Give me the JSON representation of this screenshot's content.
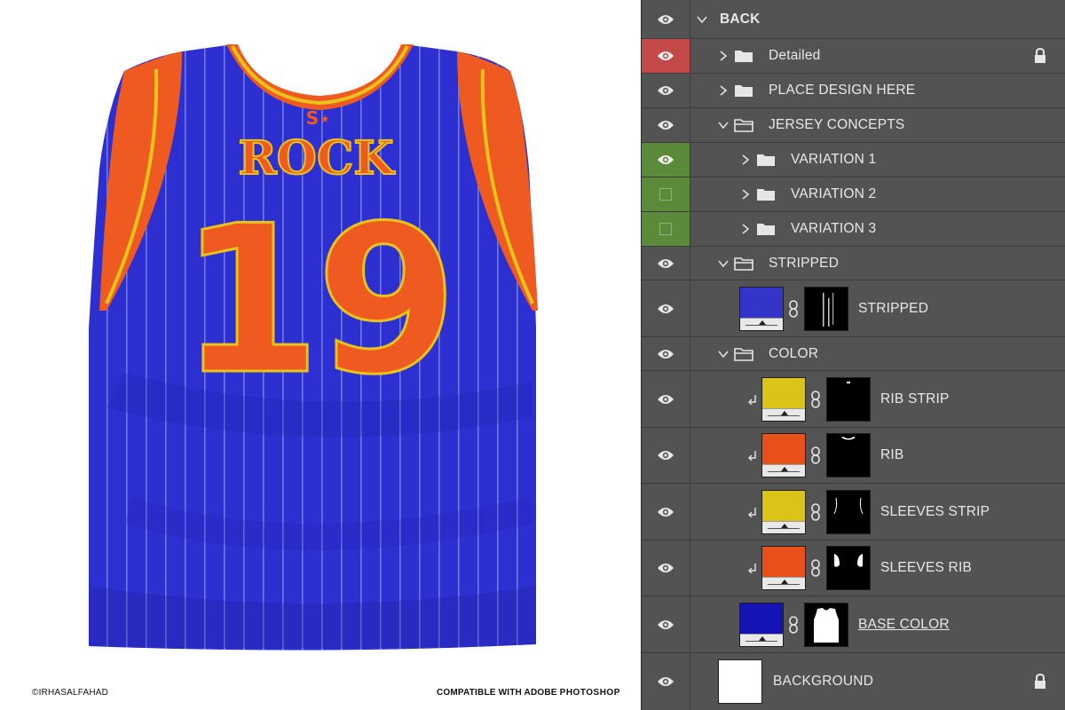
{
  "preview": {
    "jersey_name": "ROCK",
    "jersey_number": "19",
    "logo_text": "S",
    "credit": "©IRHASALFAHAD",
    "compat_prefix": "COMPATIBLE WITH ADOBE ",
    "compat_app": "PHOTOSHOP",
    "colors": {
      "base": "#2d2fd0",
      "trim": "#ee5a1f",
      "strip": "#e8c41a",
      "number": "#ee5a1f"
    }
  },
  "layers": {
    "back": "BACK",
    "detailed": "Detailed",
    "place_design": "PLACE DESIGN HERE",
    "jersey_concepts": "JERSEY CONCEPTS",
    "variation_1": "VARIATION 1",
    "variation_2": "VARIATION 2",
    "variation_3": "VARIATION 3",
    "stripped_group": "STRIPPED",
    "stripped_layer": "STRIPPED",
    "color_group": "COLOR",
    "rib_strip": "RIB STRIP",
    "rib": "RIB",
    "sleeves_strip": "SLEEVES STRIP",
    "sleeves_rib": "SLEEVES RIB",
    "base_color": "BASE COLOR",
    "background": "BACKGROUND"
  },
  "icons": [
    "eye-icon",
    "chevron-down-icon",
    "chevron-right-icon",
    "folder-icon",
    "lock-icon",
    "link-icon",
    "clip-arrow-icon"
  ],
  "swatches": {
    "stripped": "#3434c8",
    "yellow": "#dcc318",
    "orange": "#e85218",
    "base": "#1414b4"
  }
}
